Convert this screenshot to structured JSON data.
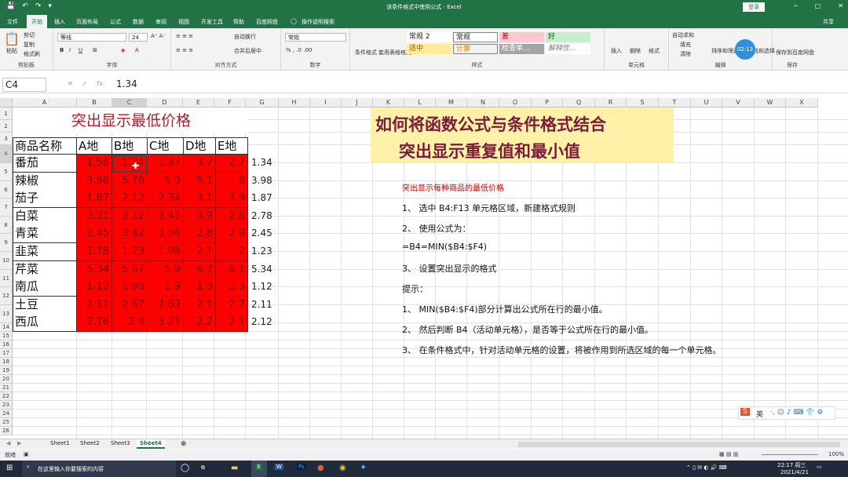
{
  "window": {
    "title": "该条件格式中使用公式 - Excel",
    "login": "登录"
  },
  "quick_access": [
    "💾",
    "↶",
    "↷",
    "▾"
  ],
  "tabs": [
    "文件",
    "开始",
    "插入",
    "页面布局",
    "公式",
    "数据",
    "审阅",
    "视图",
    "开发工具",
    "帮助",
    "百度网盘",
    "操作说明搜索",
    "共享"
  ],
  "ribbon": {
    "paste": "粘贴",
    "cut": "剪切",
    "copy": "复制",
    "painter": "格式刷",
    "clipboard": "剪贴板",
    "font_name": "等线",
    "font_size": "24",
    "font_group": "字体",
    "wrap": "自动换行",
    "merge": "合并后居中",
    "align_group": "对齐方式",
    "number_format": "常规",
    "number_group": "数字",
    "cond_format": "条件格式",
    "table_format": "套用表格格式",
    "styles": [
      "常规 2",
      "常规",
      "差",
      "好",
      "适中",
      "计算",
      "检查单...",
      "解释性..."
    ],
    "styles_group": "样式",
    "insert": "插入",
    "delete": "删除",
    "format": "格式",
    "cells_group": "单元格",
    "autosum": "自动求和",
    "fill": "填充",
    "clear": "清除",
    "sort": "排序和筛选",
    "find": "查找和选择",
    "edit_group": "编辑",
    "save_baidu": "保存到百度网盘",
    "save_group": "保存",
    "badge": "02:13"
  },
  "formula_bar": {
    "name_box": "C4",
    "formula": "1.34"
  },
  "columns": [
    "A",
    "B",
    "C",
    "D",
    "E",
    "F",
    "G",
    "H",
    "I",
    "J",
    "K",
    "L",
    "M",
    "N",
    "O",
    "P",
    "Q",
    "R",
    "S",
    "T",
    "U",
    "V",
    "W",
    "X"
  ],
  "rows": [
    "1",
    "2",
    "3",
    "4",
    "5",
    "6",
    "7",
    "8",
    "9",
    "10",
    "11",
    "12",
    "13",
    "14",
    "15",
    "16",
    "17",
    "18",
    "19",
    "20",
    "21",
    "22",
    "23",
    "24",
    "25",
    "26"
  ],
  "sheet": {
    "title": "突出显示最低价格",
    "headers": [
      "商品名称",
      "A地",
      "B地",
      "C地",
      "D地",
      "E地"
    ],
    "items": [
      {
        "name": "番茄",
        "values": [
          "1.56",
          "1.34",
          "1.87",
          "3.7",
          "2.7"
        ],
        "min": "1.34"
      },
      {
        "name": "辣椒",
        "values": [
          "3.98",
          "5.76",
          "5.9",
          "5.1",
          "6"
        ],
        "min": "3.98"
      },
      {
        "name": "茄子",
        "values": [
          "1.87",
          "2.12",
          "2.34",
          "3.1",
          "3.9"
        ],
        "min": "1.87"
      },
      {
        "name": "白菜",
        "values": [
          "3.21",
          "3.12",
          "3.45",
          "3.9",
          "2.8"
        ],
        "min": "2.78"
      },
      {
        "name": "青菜",
        "values": [
          "2.45",
          "3.42",
          "3.56",
          "2.8",
          "2.9"
        ],
        "min": "2.45"
      },
      {
        "name": "韭菜",
        "values": [
          "1.78",
          "1.23",
          "1.98",
          "2.1",
          "2"
        ],
        "min": "1.23"
      },
      {
        "name": "芹菜",
        "values": [
          "5.34",
          "5.67",
          "5.9",
          "6.2",
          "6.1"
        ],
        "min": "5.34"
      },
      {
        "name": "南瓜",
        "values": [
          "1.12",
          "1.98",
          "1.9",
          "1.3",
          "1.3"
        ],
        "min": "1.12"
      },
      {
        "name": "土豆",
        "values": [
          "2.11",
          "2.67",
          "2.69",
          "2.1",
          "2.7"
        ],
        "min": "2.11"
      },
      {
        "name": "西瓜",
        "values": [
          "2.76",
          "2.9",
          "3.21",
          "2.2",
          "2.1"
        ],
        "min": "2.12"
      }
    ]
  },
  "textbox": {
    "line1": "如何将函数公式与条件格式结合",
    "line2": "突出显示重复值和最小值"
  },
  "notes": {
    "heading": "突出显示每种商品的最低价格",
    "step1": "1、 选中 B4:F13 单元格区域，新建格式规则",
    "step2": "2、 使用公式为：",
    "formula": "=B4=MIN($B4:$F4)",
    "step3": "3、 设置突出显示的格式",
    "tip": "提示：",
    "tip1": "1、 MIN($B4:$F4)部分计算出公式所在行的最小值。",
    "tip2": "2、 然后判断 B4（活动单元格），是否等于公式所在行的最小值。",
    "tip3": "3、 在条件格式中，针对活动单元格的设置，将被作用到所选区域的每一个单元格。"
  },
  "sheet_tabs": [
    "Sheet1",
    "Sheet2",
    "Sheet3",
    "Sheet4"
  ],
  "status": {
    "mode": "就绪",
    "zoom": "100%"
  },
  "taskbar": {
    "search": "在这里输入你要搜索的内容",
    "time": "22:17 周三",
    "date": "2021/4/21",
    "ime": "英"
  }
}
